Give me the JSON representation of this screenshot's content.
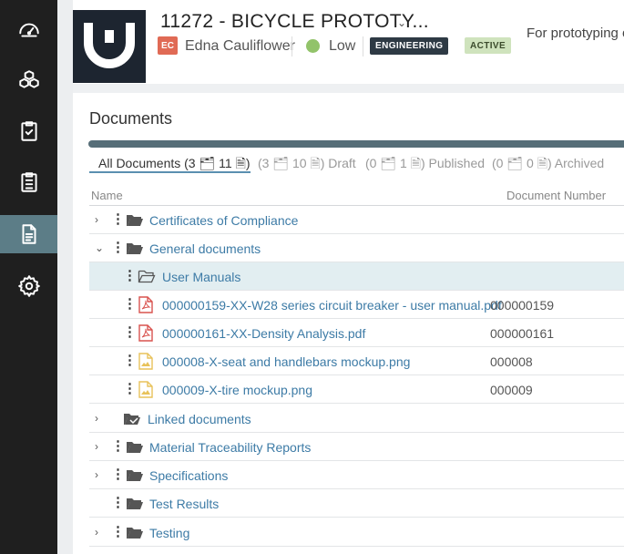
{
  "sidebar": {
    "items": [
      {
        "icon": "dashboard-icon"
      },
      {
        "icon": "cubes-icon"
      },
      {
        "icon": "clipboard-check-icon"
      },
      {
        "icon": "clipboard-list-icon"
      },
      {
        "icon": "document-icon",
        "active": true
      },
      {
        "icon": "gear-icon"
      }
    ]
  },
  "header": {
    "title": "11272 - BICYCLE PROTOTY...",
    "avatar_initials": "EC",
    "owner": "Edna Cauliflower",
    "priority": "Low",
    "department": "ENGINEERING",
    "status": "ACTIVE",
    "description": "For prototyping of"
  },
  "documents": {
    "title": "Documents",
    "filters": {
      "all": {
        "prefix": "All Documents (3",
        "mid": "11",
        "suffix": ")"
      },
      "draft": {
        "prefix": "(3",
        "mid": "10",
        "suffix": ") Draft"
      },
      "published": {
        "prefix": "(0",
        "mid": "1",
        "suffix": ") Published"
      },
      "archived": {
        "prefix": "(0",
        "mid": "0",
        "suffix": ") Archived"
      }
    },
    "columns": {
      "name": "Name",
      "number": "Document Number"
    },
    "rows": [
      {
        "label": "Certificates of Compliance",
        "number": ""
      },
      {
        "label": "General documents",
        "number": ""
      },
      {
        "label": "User Manuals",
        "number": ""
      },
      {
        "label": "000000159-XX-W28 series circuit breaker - user manual.pdf",
        "number": "000000159"
      },
      {
        "label": "000000161-XX-Density Analysis.pdf",
        "number": "000000161"
      },
      {
        "label": "000008-X-seat and handlebars mockup.png",
        "number": "000008"
      },
      {
        "label": "000009-X-tire mockup.png",
        "number": "000009"
      },
      {
        "label": "Linked documents",
        "number": ""
      },
      {
        "label": "Material Traceability Reports",
        "number": ""
      },
      {
        "label": "Specifications",
        "number": ""
      },
      {
        "label": "Test Results",
        "number": ""
      },
      {
        "label": "Testing",
        "number": ""
      }
    ]
  },
  "colors": {
    "accent": "#5c7d87",
    "link": "#3d7ba6",
    "pdf": "#d9534f",
    "image": "#e8c25a"
  }
}
